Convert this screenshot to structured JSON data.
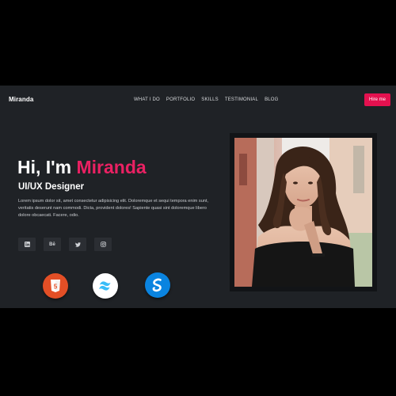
{
  "nav": {
    "brand": "Miranda",
    "links": [
      "WHAT I DO",
      "PORTFOLIO",
      "SKILLS",
      "TESTIMONIAL",
      "BLOG"
    ],
    "hire_label": "Hire me"
  },
  "hero": {
    "greeting": "Hi, I'm ",
    "name": "Miranda",
    "role": "UI/UX Designer",
    "description": "Lorem ipsum dolor sit, amet consectetur adipisicing elit. Doloremque et sequi tempora enim sunt, veritatis deserunt nam commodi. Dicta, provident dolores! Sapiente quasi sint doloremque libero dolore obcaecati. Facere, odio."
  },
  "social": {
    "icons": [
      "linkedin-icon",
      "behance-icon",
      "twitter-icon",
      "instagram-icon"
    ],
    "behance_text": "Bē"
  },
  "skills": {
    "icons": [
      "html5-icon",
      "tailwind-icon",
      "sass-icon"
    ],
    "html_badge": "5"
  },
  "colors": {
    "background": "#1f2226",
    "accent": "#e4114f",
    "name_accent": "#ea2163",
    "html": "#e34f26",
    "tailwind": "#38bdf8",
    "sass": "#0a84e0"
  }
}
